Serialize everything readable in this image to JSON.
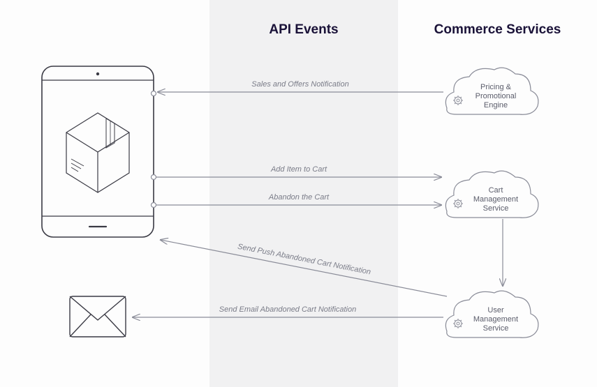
{
  "columns": {
    "mid_title": "API Events",
    "right_title": "Commerce Services"
  },
  "clouds": {
    "pricing": {
      "line1": "Pricing &",
      "line2": "Promotional",
      "line3": "Engine"
    },
    "cart": {
      "line1": "Cart",
      "line2": "Management",
      "line3": "Service"
    },
    "user": {
      "line1": "User",
      "line2": "Management",
      "line3": "Service"
    }
  },
  "arrows": {
    "sales": "Sales and Offers Notification",
    "add_cart": "Add Item to Cart",
    "abandon": "Abandon the Cart",
    "push": "Send Push Abandoned Cart Notification",
    "email": "Send Email Abandoned Cart Notification"
  }
}
